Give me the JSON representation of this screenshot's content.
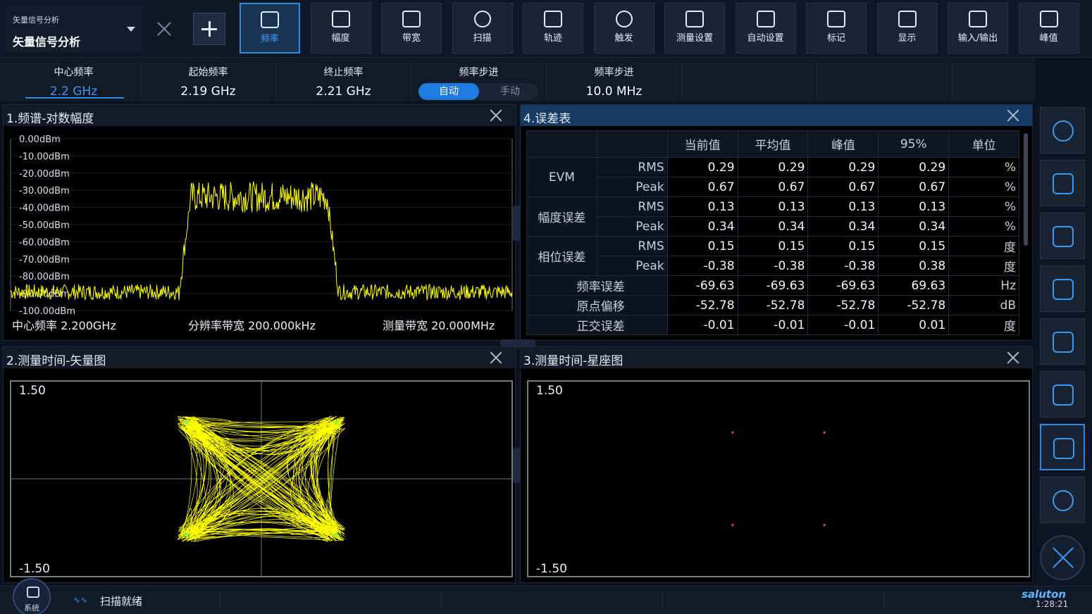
{
  "mode": {
    "subtitle": "矢量信号分析",
    "title": "矢量信号分析"
  },
  "toolbar": [
    {
      "label": "频率",
      "icon": "frequency-icon",
      "active": true
    },
    {
      "label": "幅度",
      "icon": "amplitude-icon",
      "active": false
    },
    {
      "label": "带宽",
      "icon": "bandwidth-icon",
      "active": false
    },
    {
      "label": "扫描",
      "icon": "sweep-icon",
      "active": false
    },
    {
      "label": "轨迹",
      "icon": "trace-icon",
      "active": false
    },
    {
      "label": "触发",
      "icon": "trigger-icon",
      "active": false
    },
    {
      "label": "测量设置",
      "icon": "measure-setup-icon",
      "active": false
    },
    {
      "label": "自动设置",
      "icon": "auto-setup-icon",
      "active": false
    },
    {
      "label": "标记",
      "icon": "marker-flag-icon",
      "active": false
    },
    {
      "label": "显示",
      "icon": "display-eye-icon",
      "active": false
    },
    {
      "label": "输入/输出",
      "icon": "input-output-icon",
      "active": false
    },
    {
      "label": "峰值",
      "icon": "peak-icon",
      "active": false
    }
  ],
  "params": {
    "center": {
      "label": "中心频率",
      "value": "2.2 GHz"
    },
    "start": {
      "label": "起始频率",
      "value": "2.19 GHz"
    },
    "stop": {
      "label": "终止频率",
      "value": "2.21 GHz"
    },
    "step_mode": {
      "label": "频率步进",
      "on": "自动",
      "off": "手动"
    },
    "step": {
      "label": "频率步进",
      "value": "10.0 MHz"
    }
  },
  "spectrum": {
    "title": "1.频谱-对数幅度",
    "ytick_labels": [
      "0.00dBm",
      "-10.00dBm",
      "-20.00dBm",
      "-30.00dBm",
      "-40.00dBm",
      "-50.00dBm",
      "-60.00dBm",
      "-70.00dBm",
      "-80.00dBm",
      "-90.00dBm",
      "-100.00dBm"
    ],
    "center_info": "中心频率 2.200GHz",
    "rbw_info": "分辨率带宽 200.000kHz",
    "span_info": "测量带宽 20.000MHz",
    "trace_color": "#ffff00",
    "noise_floor_dbm": -91,
    "signal_level_dbm": -32,
    "signal_band_fraction": [
      0.36,
      0.63
    ]
  },
  "error_table": {
    "title": "4.误差表",
    "headers": [
      "当前值",
      "平均值",
      "峰值",
      "95%",
      "单位"
    ],
    "groups": [
      {
        "name": "EVM",
        "rows": [
          {
            "sub": "RMS",
            "values": [
              "0.29",
              "0.29",
              "0.29",
              "0.29"
            ],
            "unit": "%"
          },
          {
            "sub": "Peak",
            "values": [
              "0.67",
              "0.67",
              "0.67",
              "0.67"
            ],
            "unit": "%"
          }
        ]
      },
      {
        "name": "幅度误差",
        "rows": [
          {
            "sub": "RMS",
            "values": [
              "0.13",
              "0.13",
              "0.13",
              "0.13"
            ],
            "unit": "%"
          },
          {
            "sub": "Peak",
            "values": [
              "0.34",
              "0.34",
              "0.34",
              "0.34"
            ],
            "unit": "%"
          }
        ]
      },
      {
        "name": "相位误差",
        "rows": [
          {
            "sub": "RMS",
            "values": [
              "0.15",
              "0.15",
              "0.15",
              "0.15"
            ],
            "unit": "度"
          },
          {
            "sub": "Peak",
            "values": [
              "-0.38",
              "-0.38",
              "-0.38",
              "0.38"
            ],
            "unit": "度"
          }
        ]
      }
    ],
    "single_rows": [
      {
        "name": "频率误差",
        "values": [
          "-69.63",
          "-69.63",
          "-69.63",
          "69.63"
        ],
        "unit": "Hz"
      },
      {
        "name": "原点偏移",
        "values": [
          "-52.78",
          "-52.78",
          "-52.78",
          "-52.78"
        ],
        "unit": "dB"
      },
      {
        "name": "正交误差",
        "values": [
          "-0.01",
          "-0.01",
          "-0.01",
          "0.01"
        ],
        "unit": "度"
      }
    ]
  },
  "vector": {
    "title": "2.测量时间-矢量图",
    "ymax": "1.50",
    "ymin": "-1.50",
    "trace_color": "#ffff00"
  },
  "constellation": {
    "title": "3.测量时间-星座图",
    "ymax": "1.50",
    "ymin": "-1.50",
    "point_color": "#ff4a1a",
    "points": [
      [
        -0.707,
        0.707
      ],
      [
        0.707,
        0.707
      ],
      [
        -0.707,
        -0.707
      ],
      [
        0.707,
        -0.707
      ]
    ]
  },
  "sidebar": [
    "forward-icon",
    "refresh-icon",
    "save-icon",
    "open-folder-icon",
    "screen-window-icon",
    "scpi-chat-icon",
    "screenshot-camera-icon",
    "help-icon"
  ],
  "status": {
    "system": "系统",
    "text": "扫描就绪",
    "time": "1:28:21",
    "logo": "saluton"
  },
  "colors": {
    "accent": "#2f8be0",
    "trace": "#ffff00",
    "panel_title_active": "#163a64"
  }
}
